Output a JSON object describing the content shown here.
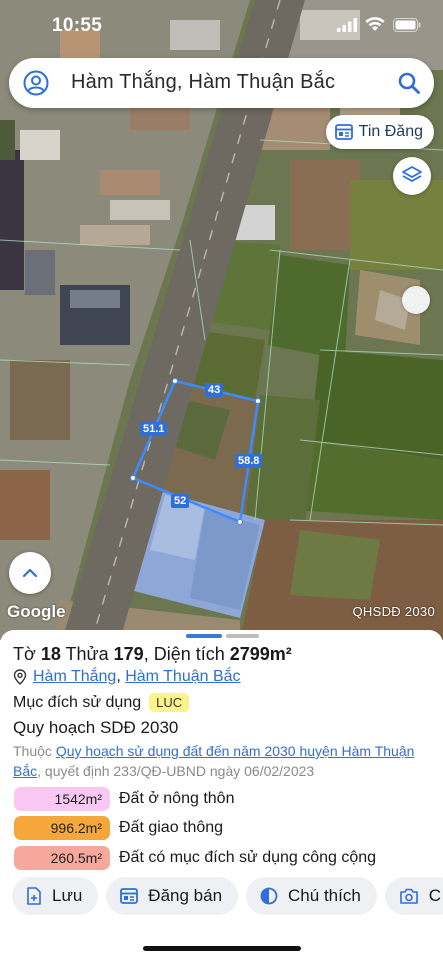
{
  "status_bar": {
    "time": "10:55"
  },
  "search": {
    "query": "Hàm Thắng, Hàm Thuận Bắc"
  },
  "map": {
    "tin_dang_label": "Tin Đăng",
    "segments": [
      "43",
      "51.1",
      "58.8",
      "52"
    ],
    "attribution": "Google",
    "layer_label": "QHSDĐ 2030"
  },
  "parcel": {
    "sheet_prefix": "Tờ",
    "sheet_number": "18",
    "plot_prefix": "Thửa",
    "plot_number": "179",
    "area_prefix": ", Diện tích",
    "area": "2799m²",
    "commune": "Hàm Thắng",
    "district": "Hàm Thuận Bắc",
    "usage_label": "Mục đích sử dụng",
    "usage_code": "LUC",
    "plan_title": "Quy hoạch SDĐ 2030",
    "note_prefix": "Thuộc",
    "note_link": "Quy hoạch sử dụng đất đến năm 2030 huyện Hàm Thuận Bắc",
    "note_suffix": ", quyết định 233/QĐ-UBND ngày 06/02/2023"
  },
  "legend": [
    {
      "area": "1542m²",
      "label": "Đất ở nông thôn",
      "color": "#f8c8f2"
    },
    {
      "area": "996.2m²",
      "label": "Đất giao thông",
      "color": "#f6a73c"
    },
    {
      "area": "260.5m²",
      "label": "Đất có mục đích sử dụng công cộng",
      "color": "#f7a89c"
    }
  ],
  "actions": {
    "save": "Lưu",
    "post": "Đăng bán",
    "legend": "Chú thích",
    "more": "C"
  },
  "colors": {
    "accent": "#2f6fd6",
    "parcel_outline": "#3b8cff"
  }
}
